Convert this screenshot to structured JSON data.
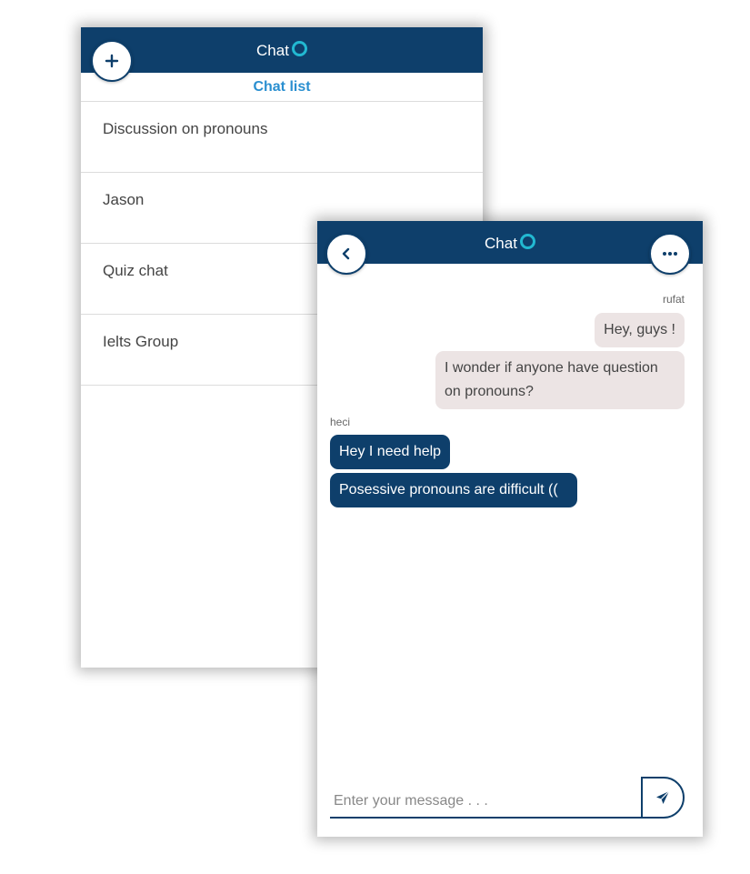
{
  "colors": {
    "header_bg": "#0e3f6b",
    "status_online": "#22b8d1",
    "subheader_text": "#2a8fd0",
    "bubble_outgoing": "#ece4e4",
    "bubble_incoming": "#0e3f6b"
  },
  "chat_list_window": {
    "header": {
      "title": "Chat",
      "status_icon": "online-status-icon",
      "add_icon": "plus-icon"
    },
    "subheader": "Chat list",
    "items": [
      {
        "label": "Discussion on pronouns"
      },
      {
        "label": "Jason"
      },
      {
        "label": "Quiz chat"
      },
      {
        "label": "Ielts Group"
      }
    ]
  },
  "conversation_window": {
    "header": {
      "title": "Chat",
      "status_icon": "online-status-icon",
      "back_icon": "chevron-left-icon",
      "more_icon": "more-dots-icon"
    },
    "messages": [
      {
        "sender": "rufat",
        "direction": "outgoing",
        "text": "Hey, guys !"
      },
      {
        "sender": "rufat",
        "direction": "outgoing",
        "text": "I wonder if anyone have question on pronouns?"
      },
      {
        "sender": "heci",
        "direction": "incoming",
        "text": "Hey I need help"
      },
      {
        "sender": "heci",
        "direction": "incoming",
        "text": "Posessive pronouns are difficult (("
      }
    ],
    "composer": {
      "placeholder": "Enter your message . . .",
      "value": "",
      "send_icon": "send-icon"
    }
  }
}
